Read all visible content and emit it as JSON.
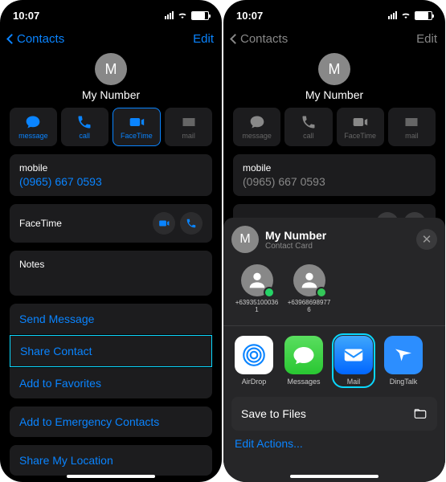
{
  "status": {
    "time": "10:07"
  },
  "nav": {
    "back": "Contacts",
    "edit": "Edit"
  },
  "contact": {
    "initial": "M",
    "name": "My Number"
  },
  "actions": {
    "message": "message",
    "call": "call",
    "facetime": "FaceTime",
    "mail": "mail"
  },
  "fields": {
    "mobile_label": "mobile",
    "mobile_value": "(0965) 667 0593",
    "facetime_label": "FaceTime",
    "notes_label": "Notes"
  },
  "links": {
    "send_message": "Send Message",
    "share_contact": "Share Contact",
    "add_favorites": "Add to Favorites",
    "add_emergency": "Add to Emergency Contacts",
    "share_location": "Share My Location"
  },
  "sheet": {
    "title": "My Number",
    "subtitle": "Contact Card",
    "targets": [
      {
        "label": "+639351000361",
        "badge_color": "#25d366"
      },
      {
        "label": "+639686989776",
        "badge_color": "#34c759"
      }
    ],
    "apps": {
      "airdrop": "AirDrop",
      "messages": "Messages",
      "mail": "Mail",
      "dingtalk": "DingTalk"
    },
    "save_files": "Save to Files",
    "edit_actions": "Edit Actions..."
  }
}
